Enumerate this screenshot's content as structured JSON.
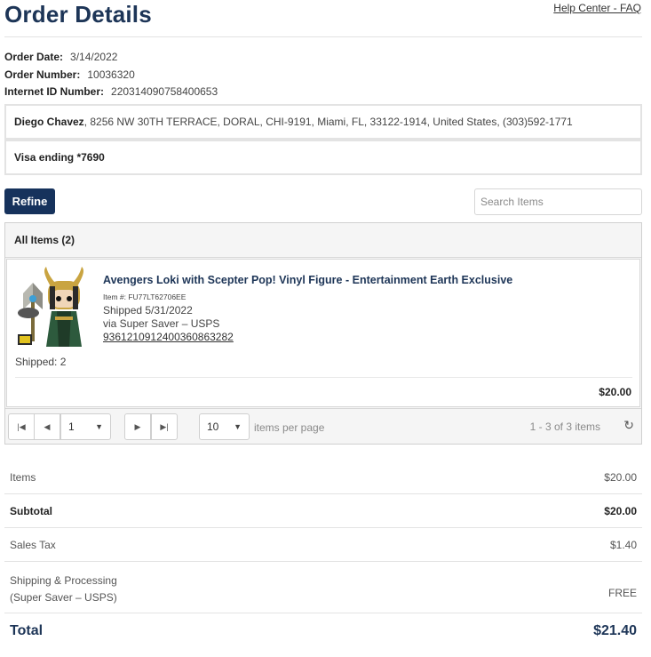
{
  "header": {
    "title": "Order Details",
    "help_link": "Help Center - FAQ"
  },
  "order": {
    "date_label": "Order Date:",
    "date": "3/14/2022",
    "number_label": "Order Number:",
    "number": "10036320",
    "internet_id_label": "Internet ID Number:",
    "internet_id": "220314090758400653"
  },
  "shipping_address": {
    "name": "Diego Chavez",
    "rest": ", 8256 NW 30TH TERRACE, DORAL, CHI-9191, Miami, FL, 33122-1914, United States, (303)592-1771"
  },
  "payment": {
    "text": "Visa ending *7690"
  },
  "toolbar": {
    "refine_label": "Refine",
    "search_placeholder": "Search Items"
  },
  "items_grid": {
    "header": "All Items (2)",
    "items": [
      {
        "name": "Avengers Loki with Scepter Pop! Vinyl Figure - Entertainment Earth Exclusive",
        "item_number": "Item #: FU77LT62706EE",
        "shipped_date": "Shipped 5/31/2022",
        "carrier": "via Super Saver – USPS",
        "tracking": "9361210912400360863282",
        "shipped_count": "Shipped: 2",
        "price": "$20.00"
      }
    ],
    "pager": {
      "page": "1",
      "page_size": "10",
      "per_page_label": "items per page",
      "range": "1 - 3 of 3 items"
    }
  },
  "summary": {
    "items_label": "Items",
    "items_value": "$20.00",
    "subtotal_label": "Subtotal",
    "subtotal_value": "$20.00",
    "tax_label": "Sales Tax",
    "tax_value": "$1.40",
    "shipping_label_1": "Shipping & Processing",
    "shipping_label_2": "(Super Saver – USPS)",
    "shipping_value": "FREE",
    "total_label": "Total",
    "total_value": "$21.40"
  },
  "colors": {
    "brand_navy": "#16325c",
    "title_navy": "#1d3557"
  }
}
